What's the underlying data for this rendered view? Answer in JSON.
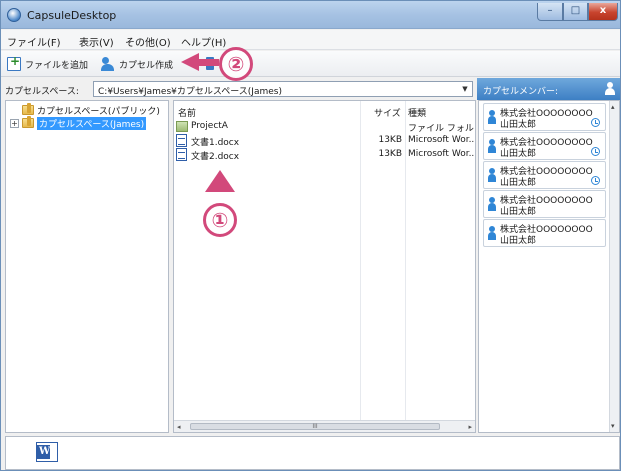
{
  "window": {
    "title": "CapsuleDesktop",
    "minimize": "–",
    "maximize": "□",
    "close": "x"
  },
  "menu": [
    {
      "label": "ファイル(F)"
    },
    {
      "label": "表示(V)"
    },
    {
      "label": "その他(O)"
    },
    {
      "label": "ヘルプ(H)"
    }
  ],
  "toolbar": {
    "add_file_label": "ファイルを追加",
    "create_capsule_label": "カプセル作成"
  },
  "annotations": {
    "step1": "①",
    "step2": "②"
  },
  "path": {
    "label": "カプセルスペース:",
    "value": "C:¥Users¥James¥カプセルスペース(James)",
    "dropdown_glyph": "▼"
  },
  "tree": {
    "items": [
      {
        "label": "カプセルスペース(パブリック)",
        "selected": false
      },
      {
        "label": "カプセルスペース(James)",
        "selected": true,
        "expander": "+"
      }
    ]
  },
  "files": {
    "headers": {
      "name": "名前",
      "size": "サイズ",
      "type": "種類"
    },
    "rows": [
      {
        "name": "ProjectA",
        "size": "",
        "type": "ファイル フォルダー",
        "kind": "folder"
      },
      {
        "name": "文書1.docx",
        "size": "13KB",
        "type": "Microsoft Wor...",
        "kind": "word"
      },
      {
        "name": "文書2.docx",
        "size": "13KB",
        "type": "Microsoft Wor...",
        "kind": "word"
      }
    ],
    "scroll": {
      "left": "◂",
      "thumb": "III",
      "right": "▸"
    }
  },
  "members": {
    "title": "カプセルメンバー:",
    "items": [
      {
        "company": "株式会社OOOOOOOO",
        "name": "山田太郎",
        "clock": true
      },
      {
        "company": "株式会社OOOOOOOO",
        "name": "山田太郎",
        "clock": true
      },
      {
        "company": "株式会社OOOOOOOO",
        "name": "山田太郎",
        "clock": true
      },
      {
        "company": "株式会社OOOOOOOO",
        "name": "山田太郎",
        "clock": false
      },
      {
        "company": "株式会社OOOOOOOO",
        "name": "山田太郎",
        "clock": false
      }
    ],
    "scroll": {
      "up": "▴",
      "down": "▾"
    }
  },
  "bottom": {
    "word_letter": "W"
  },
  "colors": {
    "accent": "#3399ff",
    "annotation": "#d2497b",
    "member_header": "#3d7fc4"
  }
}
